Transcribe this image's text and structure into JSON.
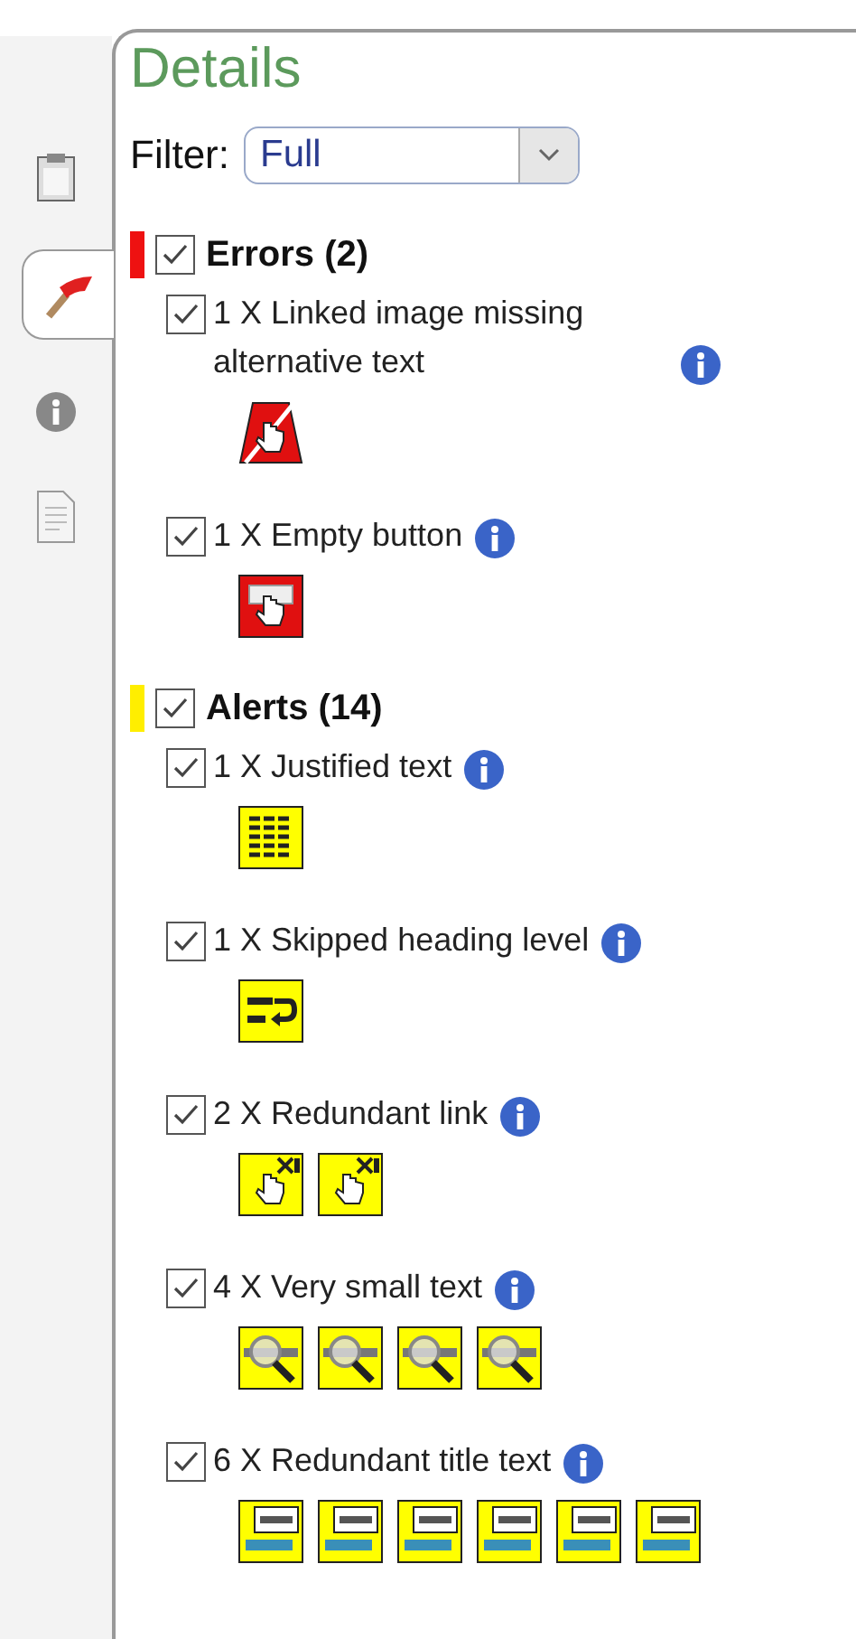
{
  "sidebar": {
    "tabs": [
      {
        "kind": "clipboard",
        "selected": false
      },
      {
        "kind": "flag",
        "selected": true
      },
      {
        "kind": "info",
        "selected": false
      },
      {
        "kind": "document",
        "selected": false
      }
    ]
  },
  "panel": {
    "title": "Details",
    "filter": {
      "label": "Filter:",
      "value": "Full"
    },
    "groups": [
      {
        "title": "Errors (2)",
        "color": "#ee1111",
        "checked": true,
        "items": [
          {
            "label": "1 X Linked image missing alternative text",
            "checked": true,
            "icons": [
              {
                "kind": "linked-image"
              }
            ]
          },
          {
            "label": "1 X Empty button",
            "checked": true,
            "icons": [
              {
                "kind": "empty-button"
              }
            ]
          }
        ]
      },
      {
        "title": "Alerts (14)",
        "color": "#ffee00",
        "checked": true,
        "items": [
          {
            "label": "1 X Justified text",
            "checked": true,
            "icons": [
              {
                "kind": "justified"
              }
            ]
          },
          {
            "label": "1 X Skipped heading level",
            "checked": true,
            "icons": [
              {
                "kind": "skipped-heading"
              }
            ]
          },
          {
            "label": "2 X Redundant link",
            "checked": true,
            "icons": [
              {
                "kind": "redundant-link"
              },
              {
                "kind": "redundant-link"
              }
            ]
          },
          {
            "label": "4 X Very small text",
            "checked": true,
            "icons": [
              {
                "kind": "small-text"
              },
              {
                "kind": "small-text"
              },
              {
                "kind": "small-text"
              },
              {
                "kind": "small-text"
              }
            ]
          },
          {
            "label": "6 X Redundant title text",
            "checked": true,
            "icons": [
              {
                "kind": "title-text"
              },
              {
                "kind": "title-text"
              },
              {
                "kind": "title-text"
              },
              {
                "kind": "title-text"
              },
              {
                "kind": "title-text"
              },
              {
                "kind": "title-text"
              }
            ]
          }
        ]
      }
    ]
  }
}
